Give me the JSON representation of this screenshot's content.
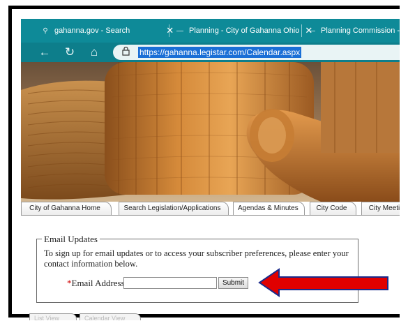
{
  "browser": {
    "tabs": [
      {
        "title": "gahanna.gov - Search",
        "icon": "search-icon",
        "close": "✕"
      },
      {
        "title": "Planning - City of Gahanna Ohio",
        "icon": "page-icon",
        "close": "✕"
      },
      {
        "title": "Planning Commission - City",
        "icon": "page-icon"
      }
    ],
    "url": "https://gahanna.legistar.com/Calendar.aspx",
    "theme_color": "#0e8a98"
  },
  "site_nav": {
    "tabs": [
      {
        "label": "City of Gahanna Home",
        "active": false
      },
      {
        "label": "Search Legislation/Applications",
        "active": false
      },
      {
        "label": "Agendas & Minutes",
        "active": true
      },
      {
        "label": "City Code",
        "active": false
      },
      {
        "label": "City Meeti",
        "active": false
      }
    ]
  },
  "email_updates": {
    "legend": "Email Updates",
    "intro": "To sign up for email updates or to access your subscriber preferences, please enter your contact information below.",
    "required_marker": "*",
    "email_label": "Email Address",
    "email_value": "",
    "submit_label": "Submit"
  },
  "annotation": {
    "arrow_color": "#e00000",
    "arrow_outline": "#1a2a8a"
  },
  "bottom_tabs": {
    "tabs": [
      {
        "label": "List View"
      },
      {
        "label": "Calendar View"
      }
    ]
  }
}
